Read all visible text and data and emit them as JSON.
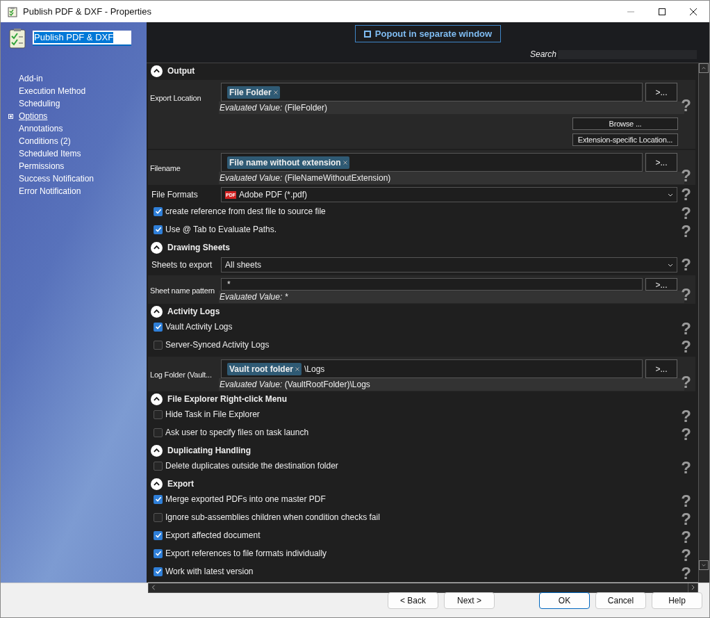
{
  "window": {
    "title": "Publish PDF & DXF - Properties"
  },
  "sidebar": {
    "name_field": "Publish PDF & DXF",
    "items": [
      {
        "label": "Add-in",
        "selected": false
      },
      {
        "label": "Execution Method",
        "selected": false
      },
      {
        "label": "Scheduling",
        "selected": false
      },
      {
        "label": "Options",
        "selected": true
      },
      {
        "label": "Annotations",
        "selected": false
      },
      {
        "label": "Conditions (2)",
        "selected": false
      },
      {
        "label": "Scheduled Items",
        "selected": false
      },
      {
        "label": "Permissions",
        "selected": false
      },
      {
        "label": "Success Notification",
        "selected": false
      },
      {
        "label": "Error Notification",
        "selected": false
      }
    ]
  },
  "popout_button": "Popout in separate window",
  "search": {
    "label": "Search"
  },
  "sections": [
    {
      "title": "Output",
      "expanded": true,
      "rows": [
        {
          "kind": "token_field",
          "label": "Export Location",
          "tokens": [
            "File Folder"
          ],
          "text": "",
          "evaluated_label": "Evaluated Value:",
          "evaluated_value": "(FileFolder)",
          "button": ">...",
          "help": "?"
        },
        {
          "kind": "buttons",
          "buttons": [
            "Browse ...",
            "Extension-specific Location..."
          ]
        },
        {
          "kind": "token_field",
          "label": "Filename",
          "tokens": [
            "File name without extension"
          ],
          "text": "",
          "evaluated_label": "Evaluated Value:",
          "evaluated_value": "(FileNameWithoutExtension)",
          "button": ">...",
          "help": "?"
        },
        {
          "kind": "select",
          "label": "File Formats",
          "value": "Adobe PDF (*.pdf)",
          "pdf_icon": "PDF",
          "help": "?"
        },
        {
          "kind": "checkbox",
          "label": "create reference from dest file to source file",
          "checked": true,
          "help": "?"
        },
        {
          "kind": "checkbox",
          "label": "Use @ Tab to Evaluate Paths.",
          "checked": true,
          "help": "?"
        }
      ]
    },
    {
      "title": "Drawing Sheets",
      "expanded": true,
      "rows": [
        {
          "kind": "select",
          "label": "Sheets to export",
          "value": "All sheets",
          "help": "?"
        },
        {
          "kind": "text_field",
          "label": "Sheet name pattern",
          "value": "*",
          "evaluated_label": "Evaluated Value:",
          "evaluated_value": "*",
          "button": ">...",
          "help": "?"
        }
      ]
    },
    {
      "title": "Activity Logs",
      "expanded": true,
      "rows": [
        {
          "kind": "checkbox",
          "label": "Vault Activity Logs",
          "checked": true,
          "help": "?"
        },
        {
          "kind": "checkbox",
          "label": "Server-Synced Activity Logs",
          "checked": false,
          "help": "?"
        },
        {
          "kind": "token_field",
          "label": "Log Folder (Vault...",
          "tokens": [
            "Vault root folder"
          ],
          "text": "\\Logs",
          "evaluated_label": "Evaluated Value:",
          "evaluated_value": "(VaultRootFolder)\\Logs",
          "button": ">...",
          "help": "?"
        }
      ]
    },
    {
      "title": "File Explorer Right-click Menu",
      "expanded": true,
      "rows": [
        {
          "kind": "checkbox",
          "label": "Hide Task in File Explorer",
          "checked": false,
          "help": "?"
        },
        {
          "kind": "checkbox",
          "label": "Ask user to specify files on task launch",
          "checked": false,
          "help": "?"
        }
      ]
    },
    {
      "title": "Duplicating Handling",
      "expanded": true,
      "rows": [
        {
          "kind": "checkbox",
          "label": "Delete duplicates outside the destination folder",
          "checked": false,
          "help": "?"
        }
      ]
    },
    {
      "title": "Export",
      "expanded": true,
      "rows": [
        {
          "kind": "checkbox",
          "label": "Merge exported PDFs into one master PDF",
          "checked": true,
          "help": "?"
        },
        {
          "kind": "checkbox",
          "label": "Ignore sub-assemblies children when condition checks fail",
          "checked": false,
          "help": "?"
        },
        {
          "kind": "checkbox",
          "label": "Export affected document",
          "checked": true,
          "help": "?"
        },
        {
          "kind": "checkbox",
          "label": "Export references to file formats individually",
          "checked": true,
          "help": "?"
        },
        {
          "kind": "checkbox",
          "label": "Work with latest version",
          "checked": true,
          "help": "?"
        }
      ]
    }
  ],
  "footer_buttons": [
    {
      "label": "< Back",
      "default": false
    },
    {
      "label": "Next >",
      "default": false
    },
    {
      "label": "OK",
      "default": true
    },
    {
      "label": "Cancel",
      "default": false
    },
    {
      "label": "Help",
      "default": false
    }
  ]
}
